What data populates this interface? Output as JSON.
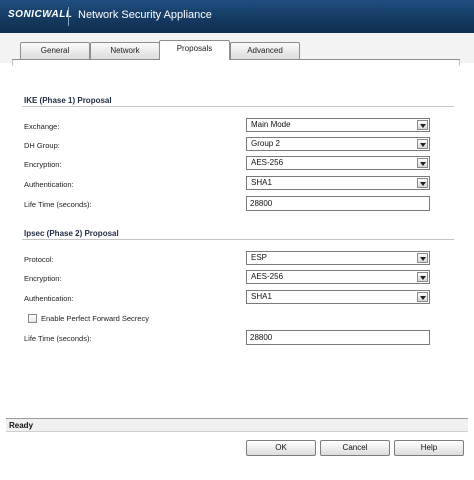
{
  "app": {
    "logo_text": "SONICWALL",
    "title": "Network Security Appliance"
  },
  "tabs": [
    {
      "label": "General",
      "active": false
    },
    {
      "label": "Network",
      "active": false
    },
    {
      "label": "Proposals",
      "active": true
    },
    {
      "label": "Advanced",
      "active": false
    }
  ],
  "ike": {
    "heading": "IKE (Phase 1) Proposal",
    "exchange": {
      "label": "Exchange:",
      "value": "Main Mode"
    },
    "dh_group": {
      "label": "DH Group:",
      "value": "Group 2"
    },
    "encryption": {
      "label": "Encryption:",
      "value": "AES-256"
    },
    "authentication": {
      "label": "Authentication:",
      "value": "SHA1"
    },
    "lifetime": {
      "label": "Life Time (seconds):",
      "value": "28800"
    }
  },
  "ipsec": {
    "heading": "Ipsec (Phase 2) Proposal",
    "protocol": {
      "label": "Protocol:",
      "value": "ESP"
    },
    "encryption": {
      "label": "Encryption:",
      "value": "AES-256"
    },
    "authentication": {
      "label": "Authentication:",
      "value": "SHA1"
    },
    "pfs": {
      "label": "Enable Perfect Forward Secrecy",
      "checked": false
    },
    "lifetime": {
      "label": "Life Time (seconds):",
      "value": "28800"
    }
  },
  "status": {
    "text": "Ready"
  },
  "buttons": {
    "ok": "OK",
    "cancel": "Cancel",
    "help": "Help"
  }
}
